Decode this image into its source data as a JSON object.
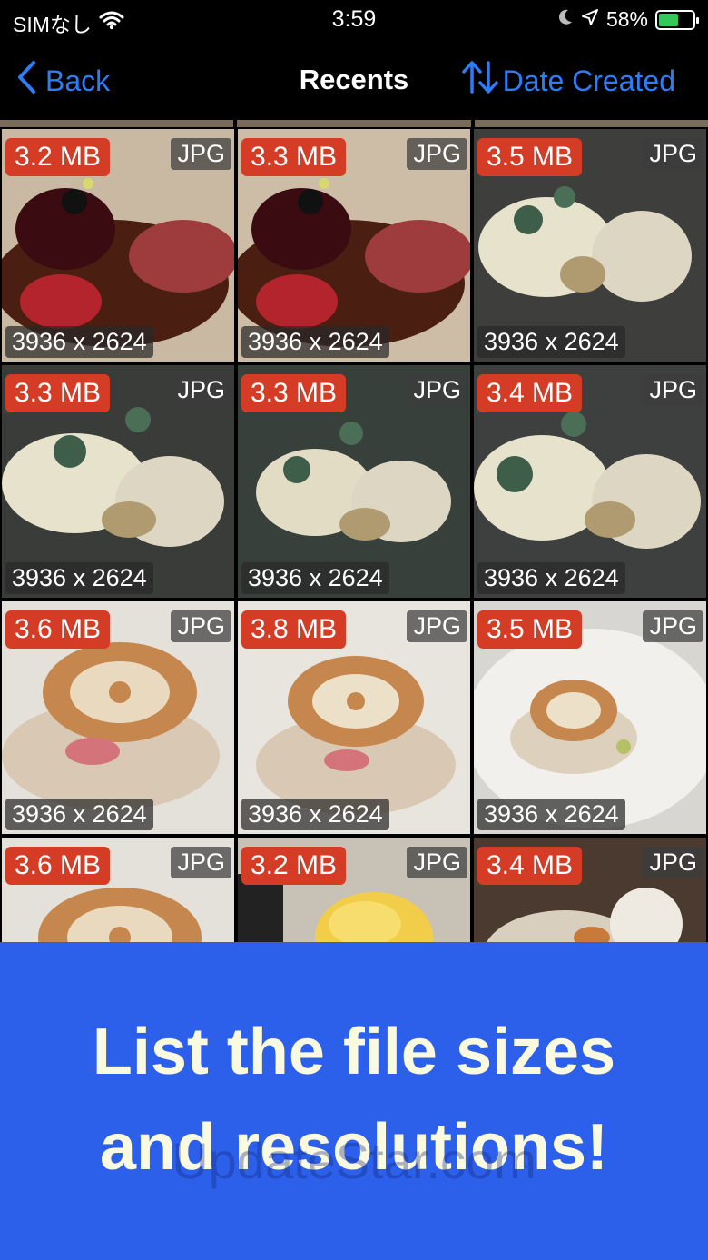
{
  "status_bar": {
    "carrier": "SIMなし",
    "time": "3:59",
    "battery_percent": "58%",
    "battery_level": 0.58,
    "icons": [
      "wifi-icon",
      "moon-icon",
      "location-arrow-icon",
      "battery-charging-icon"
    ]
  },
  "nav": {
    "back_label": "Back",
    "title": "Recents",
    "sort_label": "Date Created",
    "accent_color": "#2d7df6"
  },
  "photos": [
    {
      "size": "3.2 MB",
      "type": "JPG",
      "resolution": "3936 x 2624"
    },
    {
      "size": "3.3 MB",
      "type": "JPG",
      "resolution": "3936 x 2624"
    },
    {
      "size": "3.5 MB",
      "type": "JPG",
      "resolution": "3936 x 2624"
    },
    {
      "size": "3.3 MB",
      "type": "JPG",
      "resolution": "3936 x 2624"
    },
    {
      "size": "3.3 MB",
      "type": "JPG",
      "resolution": "3936 x 2624"
    },
    {
      "size": "3.4 MB",
      "type": "JPG",
      "resolution": "3936 x 2624"
    },
    {
      "size": "3.6 MB",
      "type": "JPG",
      "resolution": "3936 x 2624"
    },
    {
      "size": "3.8 MB",
      "type": "JPG",
      "resolution": "3936 x 2624"
    },
    {
      "size": "3.5 MB",
      "type": "JPG",
      "resolution": "3936 x 2624"
    },
    {
      "size": "3.6 MB",
      "type": "JPG",
      "resolution": ""
    },
    {
      "size": "3.2 MB",
      "type": "JPG",
      "resolution": ""
    },
    {
      "size": "3.4 MB",
      "type": "JPG",
      "resolution": ""
    }
  ],
  "badge_colors": {
    "size_badge": "#d43c26"
  },
  "banner": {
    "line1": "List the file sizes",
    "line2": "and resolutions!",
    "background": "#2d60ea",
    "watermark": "UpdateStar.com"
  }
}
